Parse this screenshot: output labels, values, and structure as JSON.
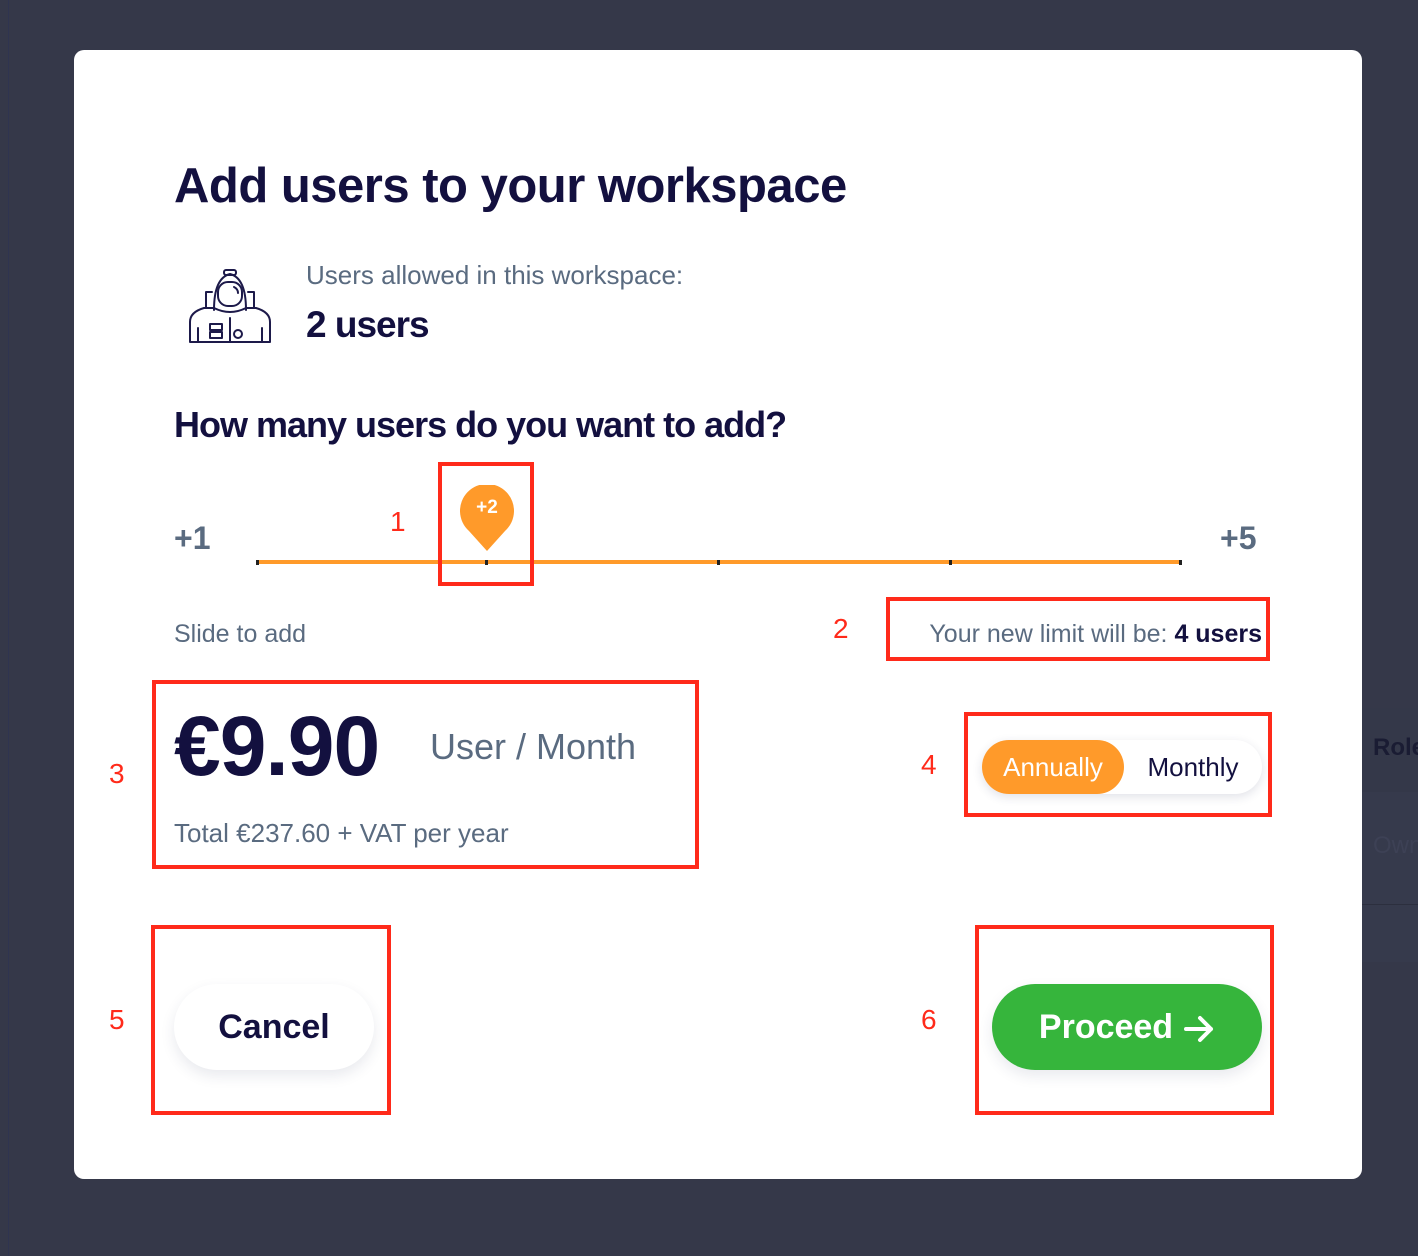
{
  "modal": {
    "title": "Add users to your workspace",
    "allowed_label": "Users allowed in this workspace:",
    "allowed_value": "2 users",
    "question": "How many users do you want to add?",
    "slider": {
      "min_label": "+1",
      "max_label": "+5",
      "min": 1,
      "max": 5,
      "value": 2,
      "thumb_label": "+2",
      "hint": "Slide to add"
    },
    "new_limit": {
      "label": "Your new limit will be:",
      "value": "4 users"
    },
    "pricing": {
      "price": "€9.90",
      "unit": "User / Month",
      "total": "Total €237.60 + VAT per year"
    },
    "billing_toggle": {
      "options": [
        "Annually",
        "Monthly"
      ],
      "selected": "Annually"
    },
    "buttons": {
      "cancel": "Cancel",
      "proceed": "Proceed"
    }
  },
  "background": {
    "table_header": "Role",
    "table_cell": "Owner"
  },
  "annotations": [
    "1",
    "2",
    "3",
    "4",
    "5",
    "6"
  ],
  "colors": {
    "accent_orange": "#ff9a2a",
    "proceed_green": "#36b53c",
    "heading_navy": "#13103f",
    "muted_text": "#5a6b80",
    "annotation_red": "#ff2a1a"
  }
}
